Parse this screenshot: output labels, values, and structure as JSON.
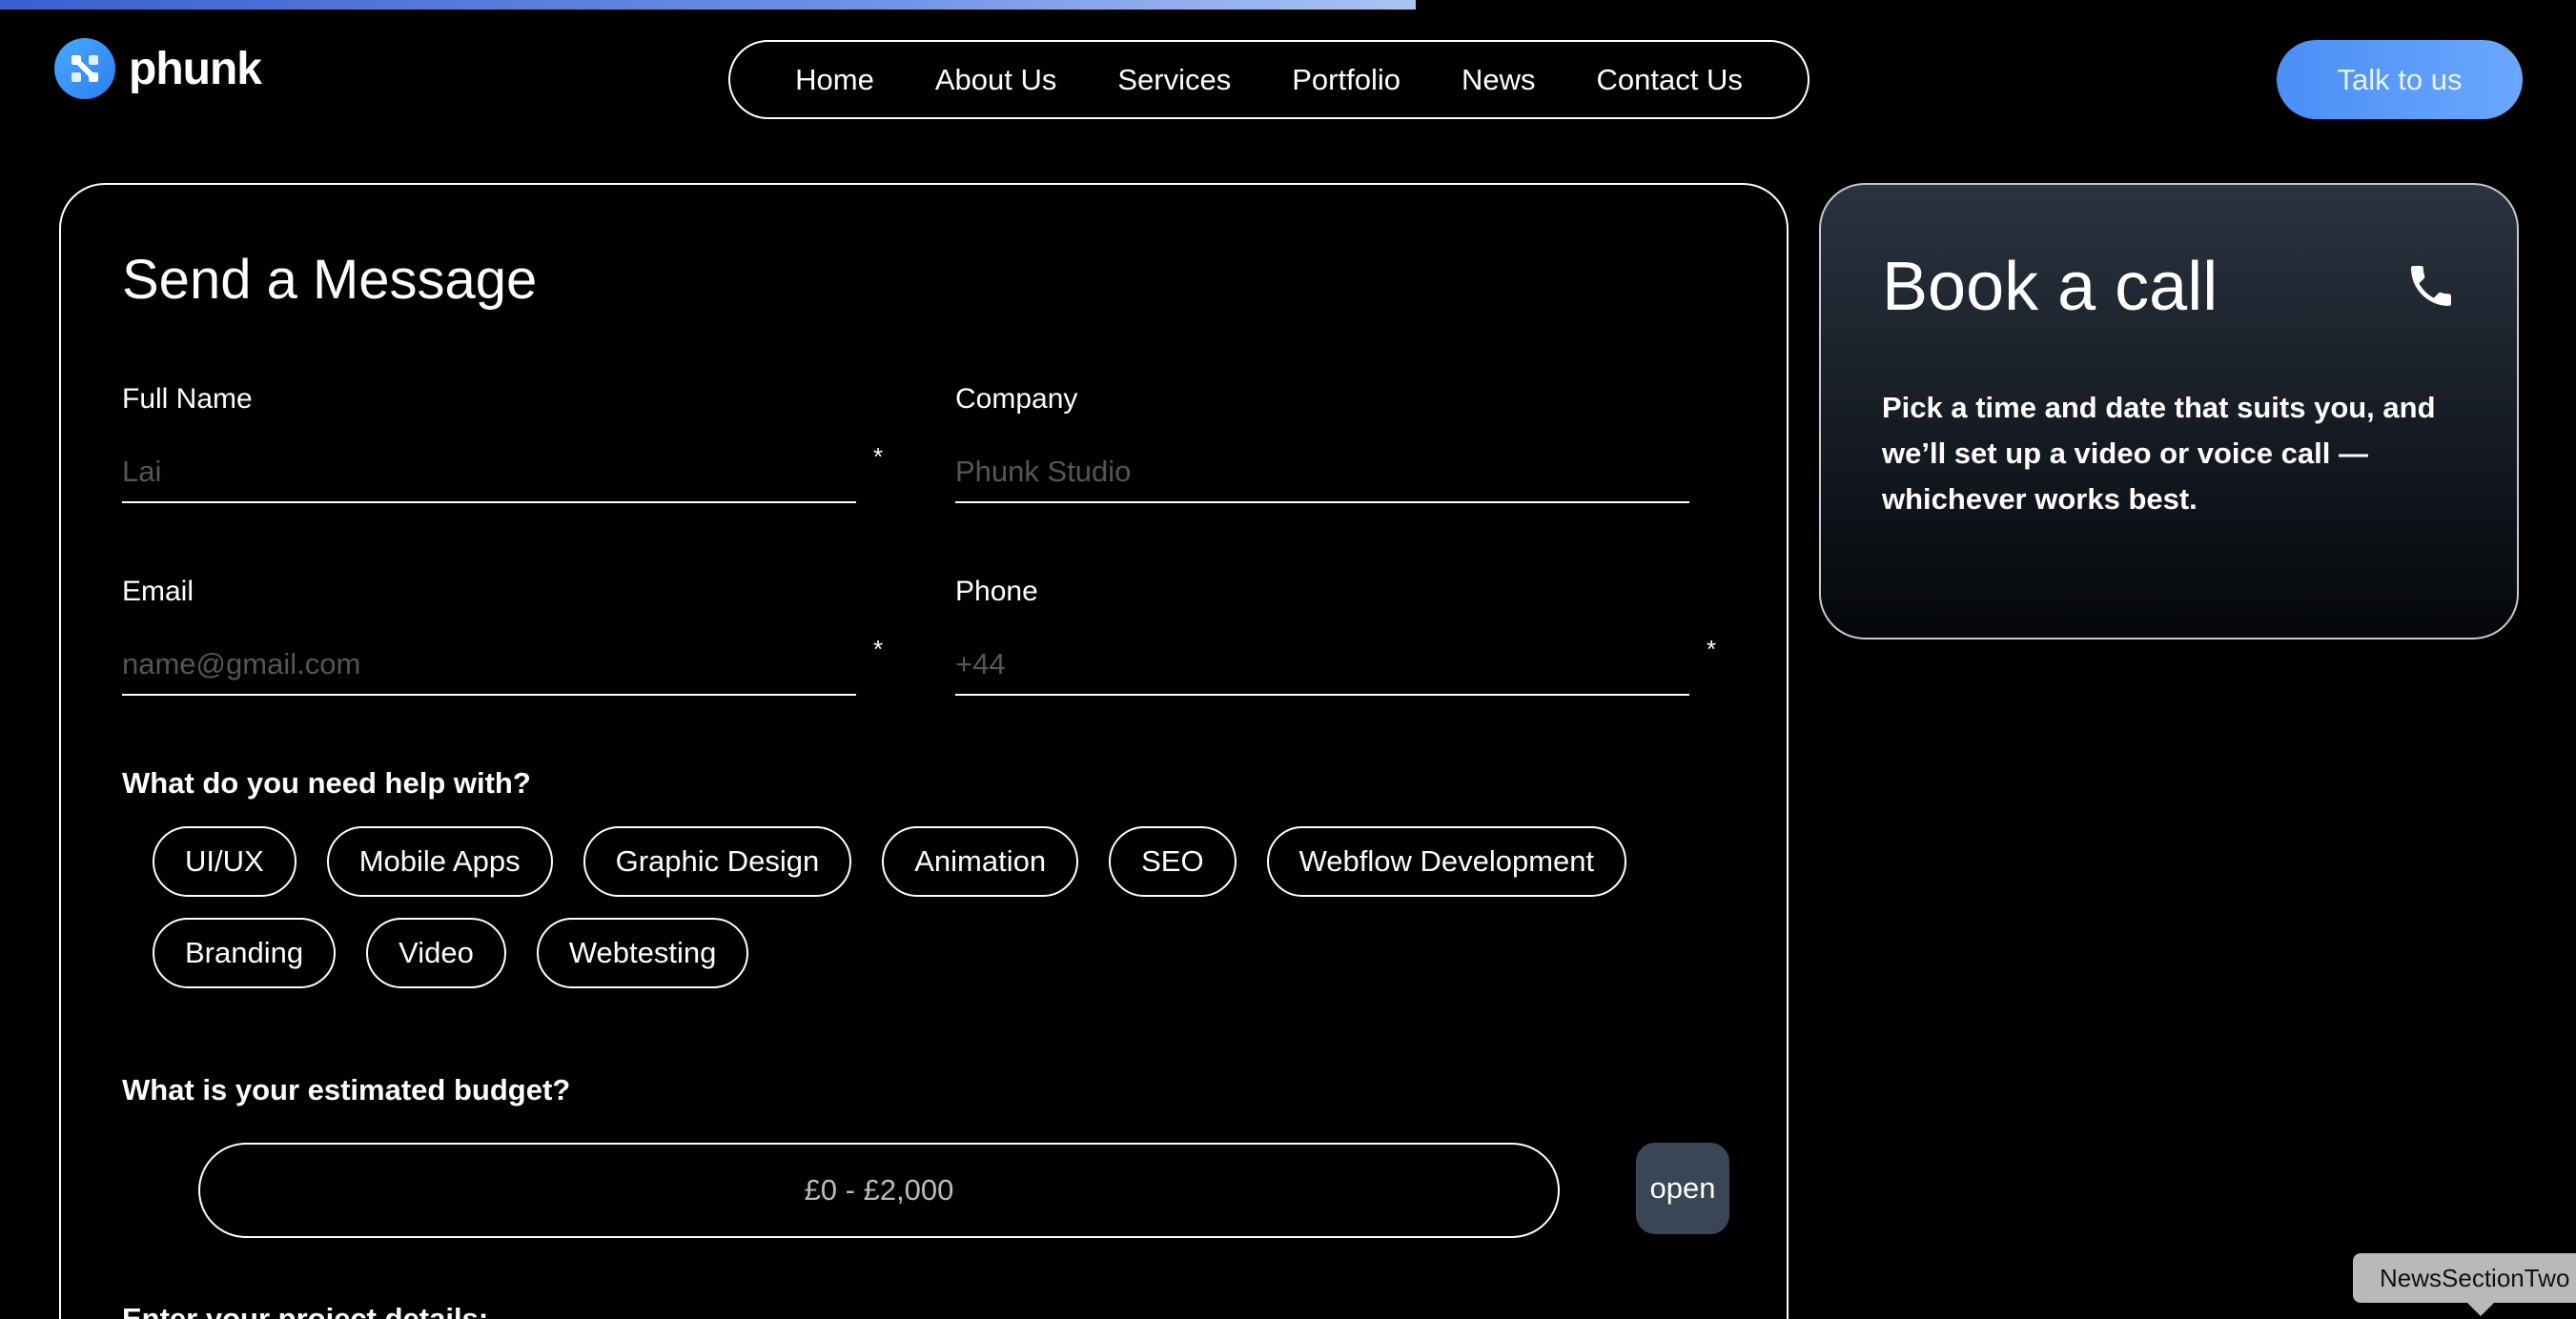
{
  "brand": {
    "name": "phunk",
    "logo_icon": "phunk-logo-mark",
    "accent": "#4b8ef5"
  },
  "page_progress": 0.55,
  "nav": {
    "items": [
      "Home",
      "About Us",
      "Services",
      "Portfolio",
      "News",
      "Contact Us"
    ]
  },
  "cta": {
    "label": "Talk to us"
  },
  "form": {
    "title": "Send a Message",
    "fields": {
      "full_name": {
        "label": "Full Name",
        "placeholder": "Lai",
        "required_mark": "*"
      },
      "company": {
        "label": "Company",
        "placeholder": "Phunk Studio"
      },
      "email": {
        "label": "Email",
        "placeholder": "name@gmail.com",
        "required_mark": "*"
      },
      "phone": {
        "label": "Phone",
        "placeholder": "+44",
        "required_mark": "*"
      }
    },
    "help_question": "What do you need help with?",
    "services": [
      "UI/UX",
      "Mobile Apps",
      "Graphic Design",
      "Animation",
      "SEO",
      "Webflow Development",
      "Branding",
      "Video",
      "Webtesting"
    ],
    "budget_question": "What is your estimated budget?",
    "budget_value": "£0 - £2,000",
    "open_label": "open",
    "project_question": "Enter your project details:"
  },
  "call_card": {
    "title": "Book a call",
    "icon": "phone-icon",
    "description": "Pick a time and date that suits you, and we’ll set up a video or voice call — whichever works best."
  },
  "tooltip": {
    "label": "NewsSectionTwo"
  }
}
